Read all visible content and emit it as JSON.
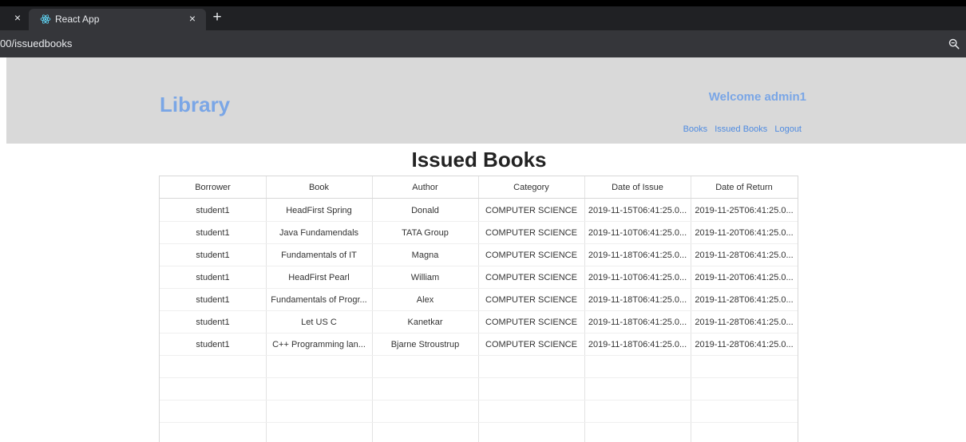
{
  "browser": {
    "left_close_glyph": "×",
    "tab_title": "React App",
    "tab_close_glyph": "×",
    "new_tab_glyph": "+",
    "address": "00/issuedbooks",
    "favicon_icon": "react-icon",
    "zoom_icon": "zoom-icon"
  },
  "header": {
    "brand": "Library",
    "welcome": "Welcome admin1",
    "nav": [
      "Books",
      "Issued Books",
      "Logout"
    ]
  },
  "page": {
    "title": "Issued Books"
  },
  "table": {
    "columns": [
      "Borrower",
      "Book",
      "Author",
      "Category",
      "Date of Issue",
      "Date of Return"
    ],
    "rows": [
      [
        "student1",
        "HeadFirst Spring",
        "Donald",
        "COMPUTER SCIENCE",
        "2019-11-15T06:41:25.0...",
        "2019-11-25T06:41:25.0..."
      ],
      [
        "student1",
        "Java Fundamendals",
        "TATA Group",
        "COMPUTER SCIENCE",
        "2019-11-10T06:41:25.0...",
        "2019-11-20T06:41:25.0..."
      ],
      [
        "student1",
        "Fundamentals of IT",
        "Magna",
        "COMPUTER SCIENCE",
        "2019-11-18T06:41:25.0...",
        "2019-11-28T06:41:25.0..."
      ],
      [
        "student1",
        "HeadFirst Pearl",
        "William",
        "COMPUTER SCIENCE",
        "2019-11-10T06:41:25.0...",
        "2019-11-20T06:41:25.0..."
      ],
      [
        "student1",
        "Fundamentals of Progr...",
        "Alex",
        "COMPUTER SCIENCE",
        "2019-11-18T06:41:25.0...",
        "2019-11-28T06:41:25.0..."
      ],
      [
        "student1",
        "Let US C",
        "Kanetkar",
        "COMPUTER SCIENCE",
        "2019-11-18T06:41:25.0...",
        "2019-11-28T06:41:25.0..."
      ],
      [
        "student1",
        "C++ Programming lan...",
        "Bjarne Stroustrup",
        "COMPUTER SCIENCE",
        "2019-11-18T06:41:25.0...",
        "2019-11-28T06:41:25.0..."
      ]
    ]
  },
  "colors": {
    "header_bg": "#d9d9d9",
    "accent": "#7aa6e6",
    "link": "#4f8be0",
    "browser_dark": "#202124",
    "browser_tab": "#35363a"
  }
}
